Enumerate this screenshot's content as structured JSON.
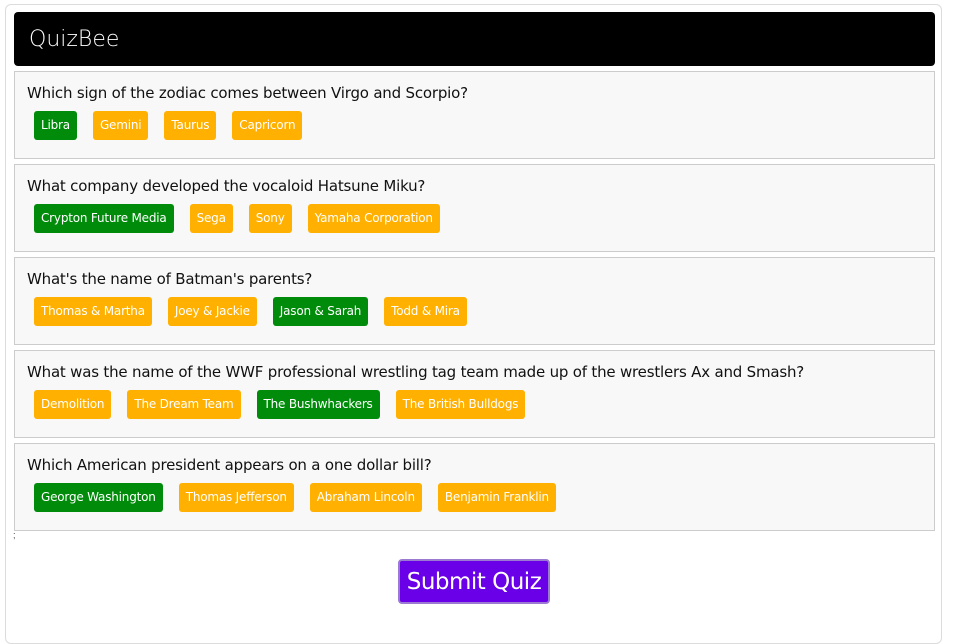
{
  "app": {
    "title": "QuizBee"
  },
  "colors": {
    "header_bg": "#000000",
    "correct": "#008c0a",
    "wrong": "#ffb000",
    "submit_bg": "#6a00e8"
  },
  "questions": [
    {
      "text": "Which sign of the zodiac comes between Virgo and Scorpio?",
      "answers": [
        {
          "label": "Libra",
          "state": "correct"
        },
        {
          "label": "Gemini",
          "state": "wrong"
        },
        {
          "label": "Taurus",
          "state": "wrong"
        },
        {
          "label": "Capricorn",
          "state": "wrong"
        }
      ]
    },
    {
      "text": "What company developed the vocaloid Hatsune Miku?",
      "answers": [
        {
          "label": "Crypton Future Media",
          "state": "correct"
        },
        {
          "label": "Sega",
          "state": "wrong"
        },
        {
          "label": "Sony",
          "state": "wrong"
        },
        {
          "label": "Yamaha Corporation",
          "state": "wrong"
        }
      ]
    },
    {
      "text": "What's the name of Batman's parents?",
      "answers": [
        {
          "label": "Thomas & Martha",
          "state": "wrong"
        },
        {
          "label": "Joey & Jackie",
          "state": "wrong"
        },
        {
          "label": "Jason & Sarah",
          "state": "correct"
        },
        {
          "label": "Todd & Mira",
          "state": "wrong"
        }
      ]
    },
    {
      "text": "What was the name of the WWF professional wrestling tag team made up of the wrestlers Ax and Smash?",
      "answers": [
        {
          "label": "Demolition",
          "state": "wrong"
        },
        {
          "label": "The Dream Team",
          "state": "wrong"
        },
        {
          "label": "The Bushwhackers",
          "state": "correct"
        },
        {
          "label": "The British Bulldogs",
          "state": "wrong"
        }
      ]
    },
    {
      "text": "Which American president appears on a one dollar bill?",
      "answers": [
        {
          "label": "George Washington",
          "state": "correct"
        },
        {
          "label": "Thomas Jefferson",
          "state": "wrong"
        },
        {
          "label": "Abraham Lincoln",
          "state": "wrong"
        },
        {
          "label": "Benjamin Franklin",
          "state": "wrong"
        }
      ]
    }
  ],
  "stray_text": ";",
  "submit": {
    "label": "Submit Quiz"
  }
}
